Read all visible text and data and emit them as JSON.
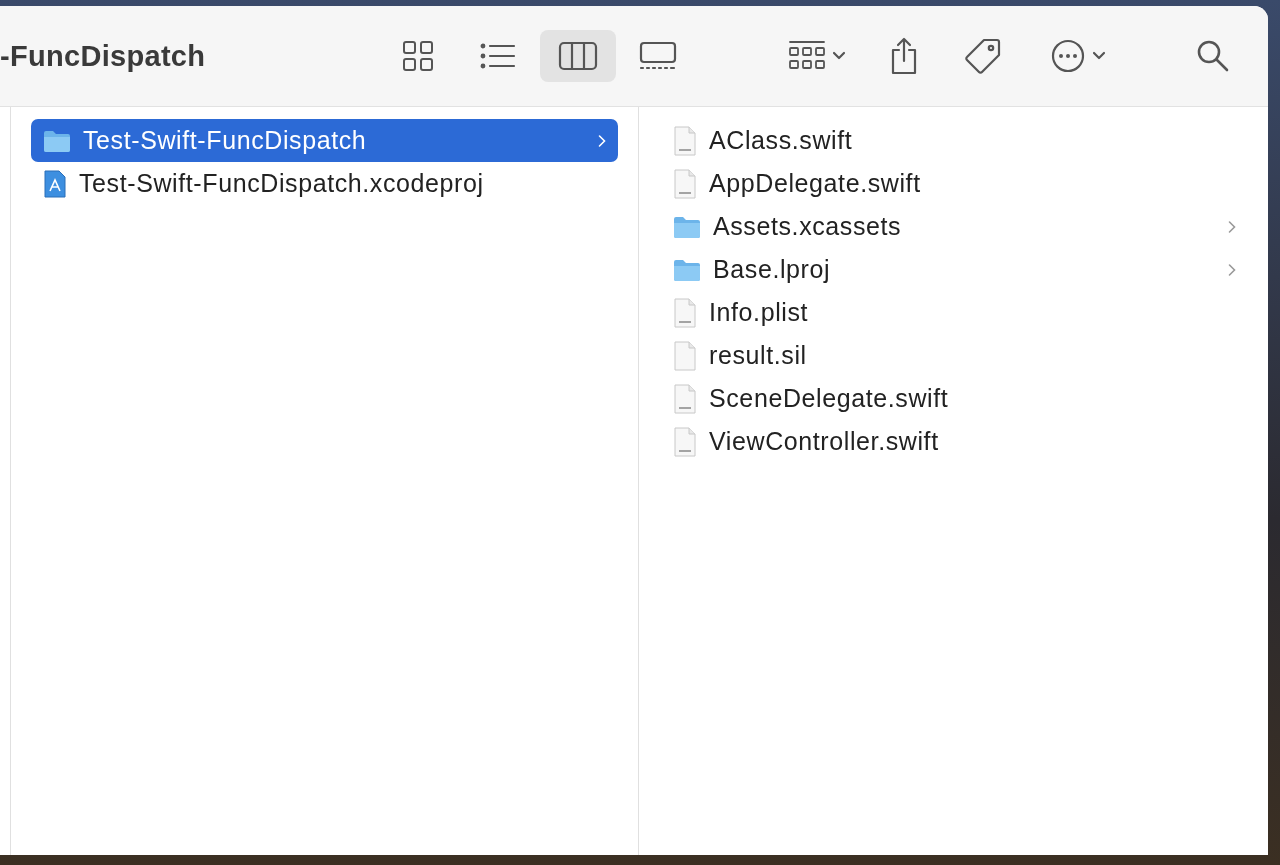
{
  "window": {
    "title": "-FuncDispatch"
  },
  "view_buttons": [
    {
      "kind": "icons",
      "selected": false
    },
    {
      "kind": "list",
      "selected": false
    },
    {
      "kind": "columns",
      "selected": true
    },
    {
      "kind": "gallery",
      "selected": false
    }
  ],
  "columns": [
    {
      "items": [
        {
          "name": "Test-Swift-FuncDispatch",
          "kind": "folder",
          "selected": true,
          "expandable": true
        },
        {
          "name": "Test-Swift-FuncDispatch.xcodeproj",
          "kind": "xcodeproj",
          "selected": false,
          "expandable": false
        }
      ]
    },
    {
      "items": [
        {
          "name": "AClass.swift",
          "kind": "swift",
          "selected": false,
          "expandable": false
        },
        {
          "name": "AppDelegate.swift",
          "kind": "swift",
          "selected": false,
          "expandable": false
        },
        {
          "name": "Assets.xcassets",
          "kind": "folder",
          "selected": false,
          "expandable": true
        },
        {
          "name": "Base.lproj",
          "kind": "folder",
          "selected": false,
          "expandable": true
        },
        {
          "name": "Info.plist",
          "kind": "plist",
          "selected": false,
          "expandable": false
        },
        {
          "name": "result.sil",
          "kind": "blank",
          "selected": false,
          "expandable": false
        },
        {
          "name": "SceneDelegate.swift",
          "kind": "swift",
          "selected": false,
          "expandable": false
        },
        {
          "name": "ViewController.swift",
          "kind": "swift",
          "selected": false,
          "expandable": false
        }
      ]
    }
  ]
}
